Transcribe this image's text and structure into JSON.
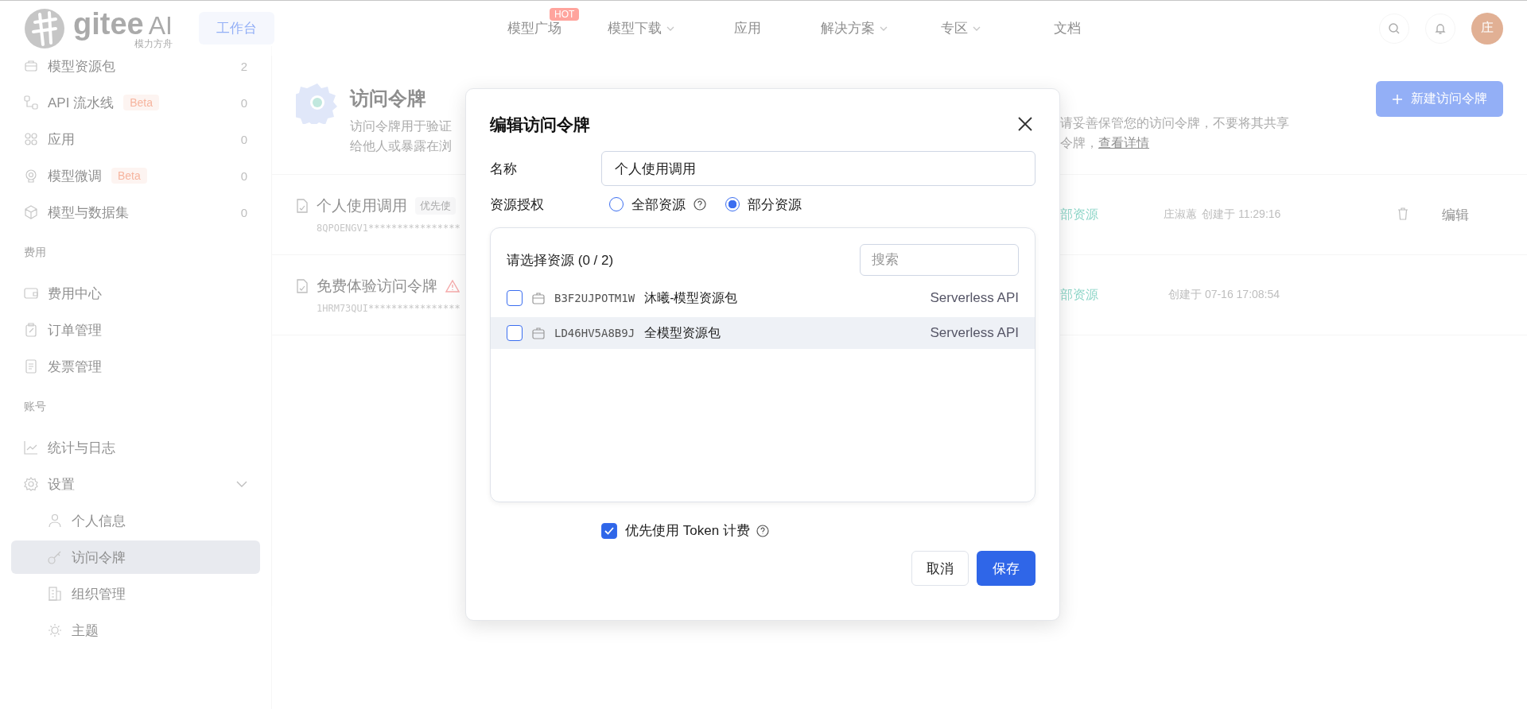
{
  "top_nav": {
    "logo": "gitee",
    "logo_suffix": "AI",
    "logo_subtitle": "模力方舟",
    "workspace_button": "工作台",
    "items": [
      {
        "label": "模型广场",
        "badge": "HOT",
        "dropdown": false
      },
      {
        "label": "模型下载",
        "dropdown": true
      },
      {
        "label": "应用",
        "dropdown": false
      },
      {
        "label": "解决方案",
        "dropdown": true
      },
      {
        "label": "专区",
        "dropdown": true
      },
      {
        "label": "文档",
        "dropdown": false
      }
    ],
    "avatar": "庄"
  },
  "sidebar": {
    "sections": [
      {
        "items": [
          {
            "label": "模型资源包",
            "count": "2",
            "selected": false
          },
          {
            "label": "API 流水线",
            "badge": "Beta",
            "count": "0",
            "selected": false
          },
          {
            "label": "应用",
            "count": "0",
            "selected": false
          },
          {
            "label": "模型微调",
            "badge": "Beta",
            "count": "0",
            "selected": false
          },
          {
            "label": "模型与数据集",
            "count": "0",
            "selected": false
          }
        ]
      },
      {
        "title": "费用",
        "items": [
          {
            "label": "费用中心",
            "selected": false
          },
          {
            "label": "订单管理",
            "selected": false
          },
          {
            "label": "发票管理",
            "selected": false
          }
        ]
      },
      {
        "title": "账号",
        "items": [
          {
            "label": "统计与日志",
            "selected": false
          },
          {
            "label": "设置",
            "selected": false,
            "expanded": true,
            "children": [
              {
                "label": "个人信息",
                "selected": false
              },
              {
                "label": "访问令牌",
                "selected": true
              },
              {
                "label": "组织管理",
                "selected": false
              },
              {
                "label": "主题",
                "selected": false
              }
            ]
          }
        ]
      }
    ]
  },
  "page": {
    "title": "访问令牌",
    "description_left": [
      "访问令牌用于验证",
      "给他人或暴露在浏"
    ],
    "description_right": [
      "请妥善保管您的访问令牌，不要将其共享",
      "令牌，"
    ],
    "details_link": "查看详情",
    "new_button": "新建访问令牌"
  },
  "tokens": [
    {
      "name": "个人使用调用",
      "tag": "优先使",
      "warning": false,
      "key": "8QPOENGV1****************",
      "scope": "部资源",
      "creator": "庄淑蕙",
      "created": "创建于 11:29:16",
      "deletable": true,
      "edit": "编辑"
    },
    {
      "name": "免费体验访问令牌",
      "warning": true,
      "key": "1HRM73QUI****************",
      "scope": "部资源",
      "created": "创建于 07-16 17:08:54",
      "deletable": false
    }
  ],
  "dialog": {
    "title": "编辑访问令牌",
    "name_label": "名称",
    "name_value": "个人使用调用",
    "auth_label": "资源授权",
    "auth_options": [
      {
        "label": "全部资源",
        "selected": false,
        "help": true
      },
      {
        "label": "部分资源",
        "selected": true,
        "help": false
      }
    ],
    "resource_panel": {
      "title": "请选择资源 (0 / 2)",
      "search": {
        "placeholder": "搜索"
      },
      "resources": [
        {
          "code": "B3F2UJPOTM1W",
          "name": "沐曦-模型资源包",
          "type": "Serverless API",
          "checked": false,
          "hovered": false
        },
        {
          "code": "LD46HV5A8B9J",
          "name": "全模型资源包",
          "type": "Serverless API",
          "checked": false,
          "hovered": true
        }
      ]
    },
    "token_billing": {
      "label": "优先使用 Token 计费",
      "checked": true,
      "help": true
    },
    "cancel_button": "取消",
    "save_button": "保存"
  }
}
